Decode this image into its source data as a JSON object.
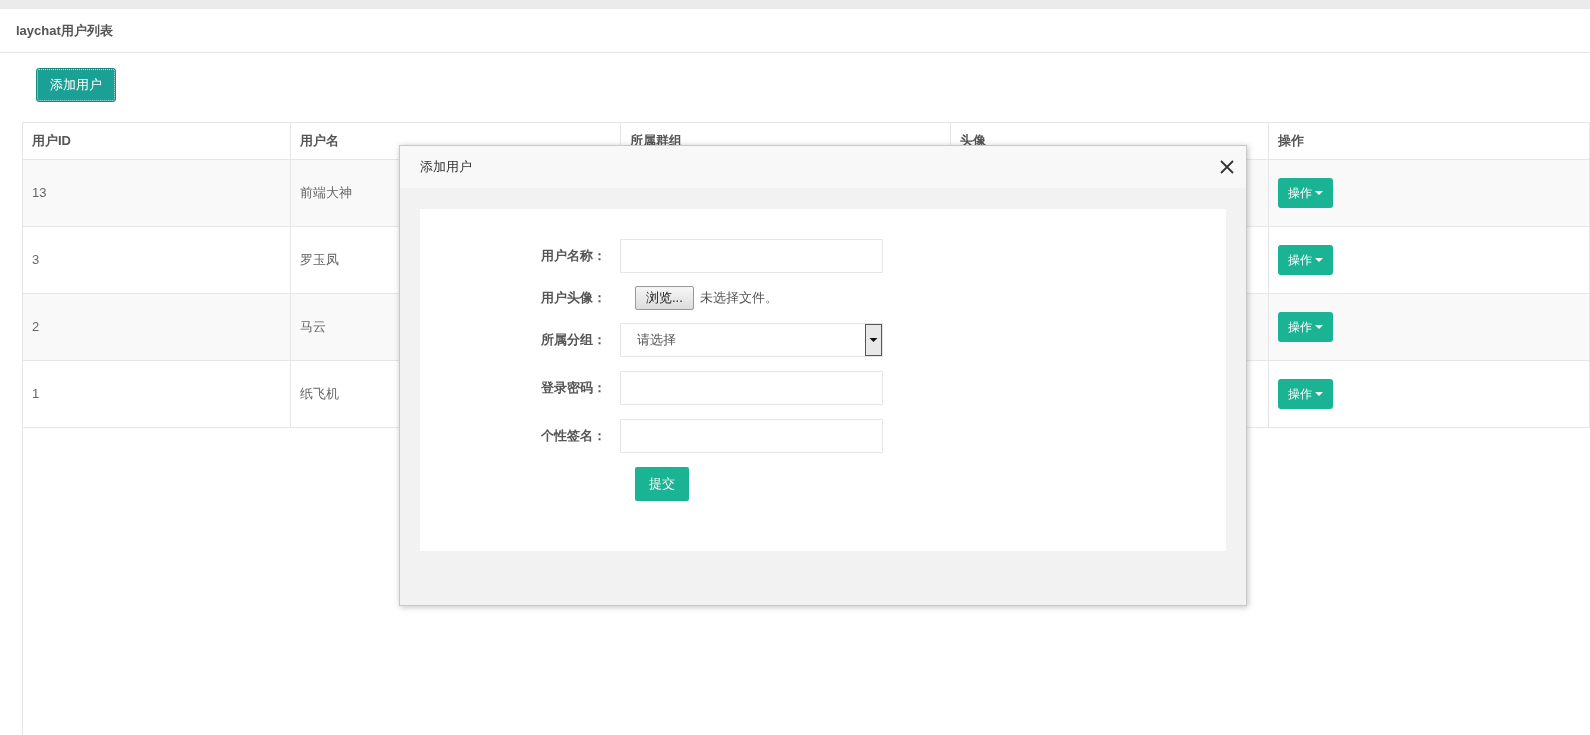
{
  "panel": {
    "title": "laychat用户列表"
  },
  "add_button": "添加用户",
  "table": {
    "columns": [
      "用户ID",
      "用户名",
      "所属群组",
      "头像",
      "操作"
    ],
    "rows": [
      {
        "id": "13",
        "name": "前端大神",
        "action": "操作"
      },
      {
        "id": "3",
        "name": "罗玉凤",
        "action": "操作"
      },
      {
        "id": "2",
        "name": "马云",
        "action": "操作"
      },
      {
        "id": "1",
        "name": "纸飞机",
        "action": "操作"
      }
    ]
  },
  "dialog": {
    "title": "添加用户",
    "fields": [
      {
        "kind": "text",
        "label": "用户名称："
      },
      {
        "kind": "file",
        "label": "用户头像：",
        "button": "浏览...",
        "status": "未选择文件。"
      },
      {
        "kind": "select",
        "label": "所属分组：",
        "value": "请选择"
      },
      {
        "kind": "password",
        "label": "登录密码："
      },
      {
        "kind": "text",
        "label": "个性签名："
      }
    ],
    "submit": "提交"
  }
}
